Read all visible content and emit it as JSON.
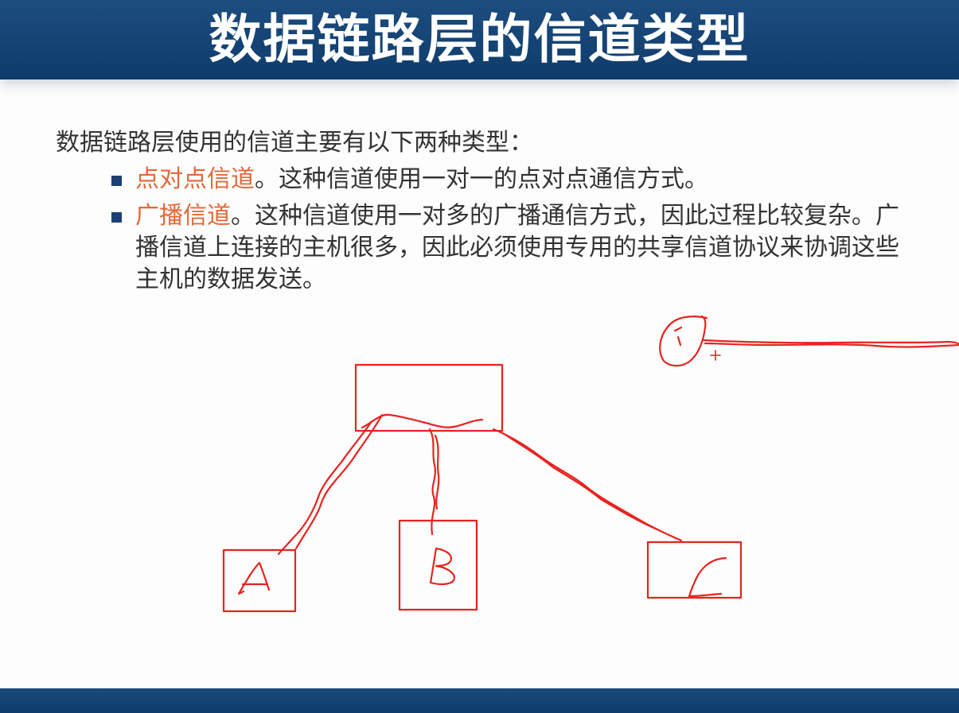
{
  "slide": {
    "title": "数据链路层的信道类型",
    "intro": "数据链路层使用的信道主要有以下两种类型：",
    "bullets": [
      {
        "term": "点对点信道",
        "text": "。这种信道使用一对一的点对点通信方式。"
      },
      {
        "term": "广播信道",
        "text": "。这种信道使用一对多的广播通信方式，因此过程比较复杂。广播信道上连接的主机很多，因此必须使用专用的共享信道协议来协调这些主机的数据发送。"
      }
    ]
  },
  "colors": {
    "title_bar": "#0e3b6b",
    "title_text": "#ffffff",
    "body_text": "#333333",
    "term_accent": "#e4683a",
    "bullet_square": "#1e3f73",
    "pen_ink": "#e8231f"
  },
  "annotation": {
    "node_labels": [
      "A",
      "B",
      "C"
    ]
  }
}
